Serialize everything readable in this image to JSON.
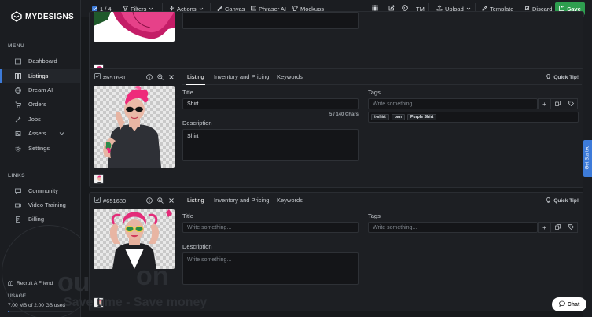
{
  "brand": {
    "name": "MYDESIGNS"
  },
  "sidebar": {
    "menu_label": "MENU",
    "menu_items": [
      {
        "label": "Dashboard",
        "icon": "dashboard-icon",
        "active": false
      },
      {
        "label": "Listings",
        "icon": "listings-icon",
        "active": true
      },
      {
        "label": "Dream AI",
        "icon": "globe-icon",
        "active": false
      },
      {
        "label": "Orders",
        "icon": "cart-icon",
        "active": false
      },
      {
        "label": "Jobs",
        "icon": "jobs-icon",
        "active": false
      },
      {
        "label": "Assets",
        "icon": "assets-icon",
        "active": false
      },
      {
        "label": "Settings",
        "icon": "gear-icon",
        "active": false
      }
    ],
    "links_label": "LINKS",
    "link_items": [
      {
        "label": "Community",
        "icon": "community-icon"
      },
      {
        "label": "Video Training",
        "icon": "video-icon"
      },
      {
        "label": "Billing",
        "icon": "billing-icon"
      }
    ],
    "recruit_label": "Recruit A Friend",
    "usage_label": "USAGE",
    "usage_text": "7.00 MB of 2.00 GB used",
    "usage_fraction": 0.0034
  },
  "toolbar": {
    "selection": "1 / 4",
    "filters": "Filters",
    "actions": "Actions",
    "canvas": "Canvas",
    "phraser": "Phraser AI",
    "mockups": "Mockups",
    "tm": "TM",
    "upload": "Upload",
    "template": "Template",
    "discard": "Discard",
    "save": "Save"
  },
  "cards": [
    {
      "id": "#651681",
      "tabs": [
        "Listing",
        "Inventory and Pricing",
        "Keywords"
      ],
      "quick_tip": "Quick Tip!",
      "title_label": "Title",
      "title_value": "Shirt",
      "char_count": "5 / 140 Chars",
      "description_label": "Description",
      "description_value": "Shirt",
      "tags_label": "Tags",
      "tags_placeholder": "Write something...",
      "tags": [
        "t-shirt",
        "pan",
        "Purple Shirt"
      ]
    },
    {
      "id": "#651680",
      "tabs": [
        "Listing",
        "Inventory and Pricing",
        "Keywords"
      ],
      "quick_tip": "Quick Tip!",
      "title_label": "Title",
      "title_placeholder": "Write something...",
      "description_label": "Description",
      "description_placeholder": "Write something...",
      "tags_label": "Tags",
      "tags_placeholder": "Write something..."
    }
  ],
  "side_tab": "Get Started",
  "chat": "Chat",
  "watermark": {
    "line1": "ou",
    "line2": "on",
    "line3": "Save time - Save money"
  }
}
